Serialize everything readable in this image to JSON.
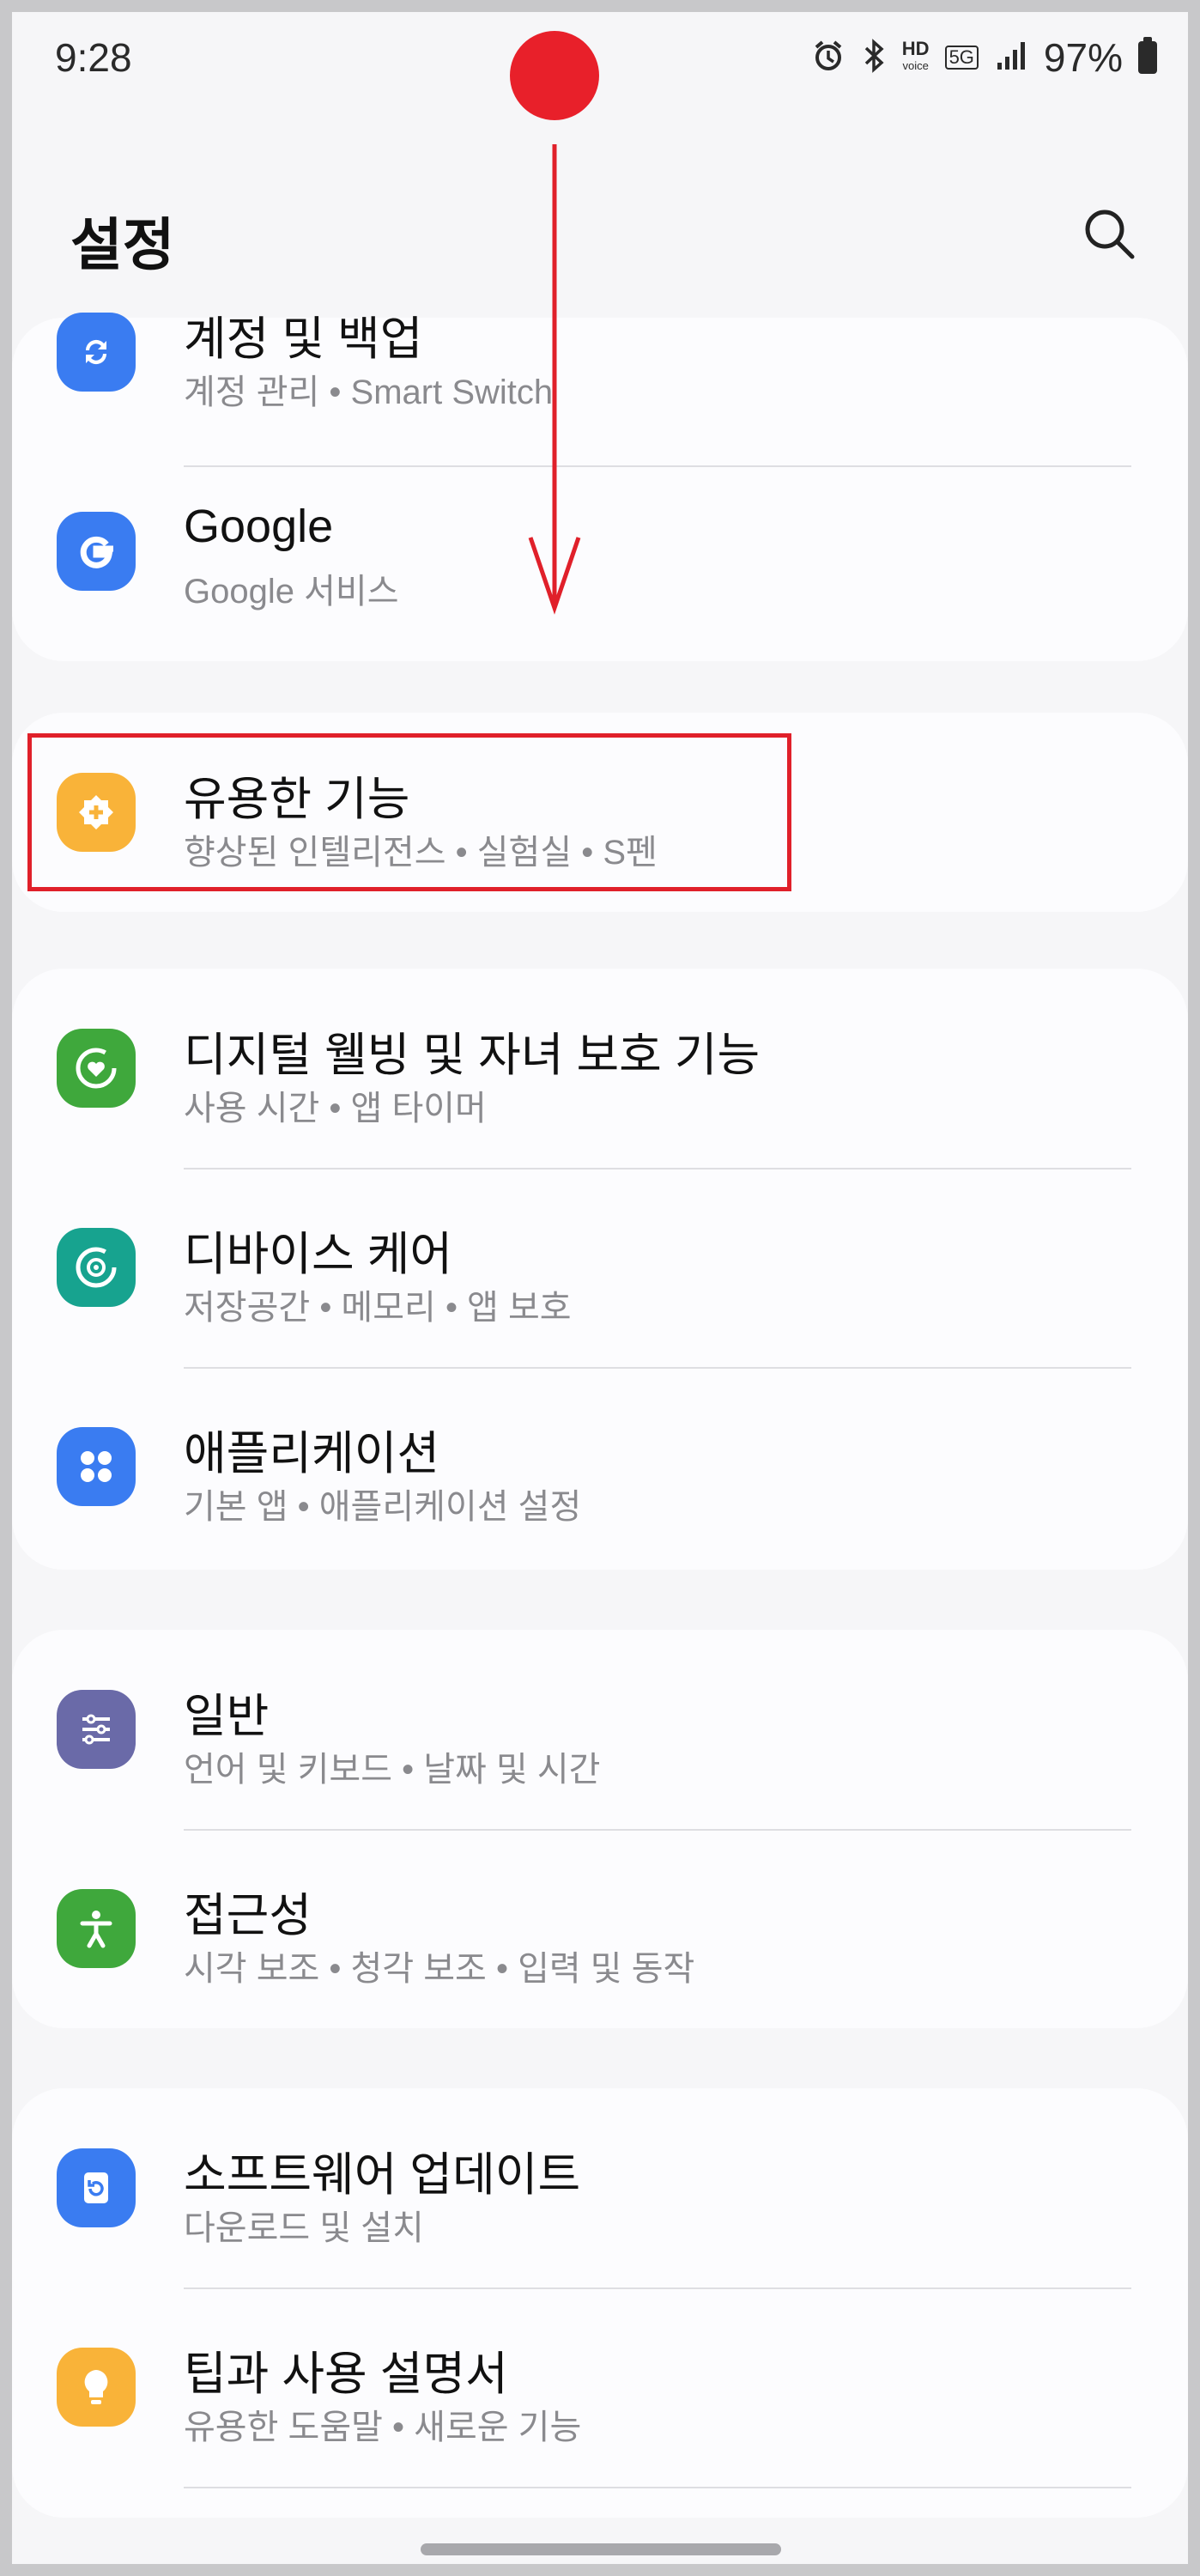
{
  "status_bar": {
    "time": "9:28",
    "hd_label": "HD",
    "hd_sub": "voice",
    "network": "5G",
    "battery": "97%"
  },
  "header": {
    "title": "설정"
  },
  "icons": {
    "search": "search-icon",
    "accounts": "sync-icon",
    "google": "google-g-icon",
    "advanced": "puzzle-plus-icon",
    "wellbeing": "heart-circle-icon",
    "device_care": "refresh-circle-icon",
    "apps": "four-dots-icon",
    "general": "sliders-icon",
    "accessibility": "person-icon",
    "software_update": "update-icon",
    "tips": "lightbulb-icon"
  },
  "colors": {
    "accounts": "#3a7cf1",
    "google": "#3a7cf1",
    "advanced": "#f9b339",
    "wellbeing": "#3fa83c",
    "device_care": "#17a38f",
    "apps": "#3a7cf1",
    "general": "#6a6aa8",
    "accessibility": "#3fa83c",
    "software_update": "#3a7cf1",
    "tips": "#f9b339",
    "annotation": "#e0202a"
  },
  "settings": {
    "accounts": {
      "title": "계정 및 백업",
      "subtitle": "계정 관리  •  Smart Switch"
    },
    "google": {
      "title": "Google",
      "subtitle": "Google 서비스"
    },
    "advanced": {
      "title": "유용한 기능",
      "subtitle": "향상된 인텔리전스  •  실험실  •  S펜"
    },
    "wellbeing": {
      "title": "디지털 웰빙 및 자녀 보호 기능",
      "subtitle": "사용 시간  •  앱 타이머"
    },
    "device_care": {
      "title": "디바이스 케어",
      "subtitle": "저장공간  •  메모리  •  앱 보호"
    },
    "apps": {
      "title": "애플리케이션",
      "subtitle": "기본 앱  •  애플리케이션 설정"
    },
    "general": {
      "title": "일반",
      "subtitle": "언어 및 키보드  •  날짜 및 시간"
    },
    "accessibility": {
      "title": "접근성",
      "subtitle": "시각 보조  •  청각 보조  •  입력 및 동작"
    },
    "software_update": {
      "title": "소프트웨어 업데이트",
      "subtitle": "다운로드 및 설치"
    },
    "tips": {
      "title": "팁과 사용 설명서",
      "subtitle": "유용한 도움말  •  새로운 기능"
    }
  }
}
